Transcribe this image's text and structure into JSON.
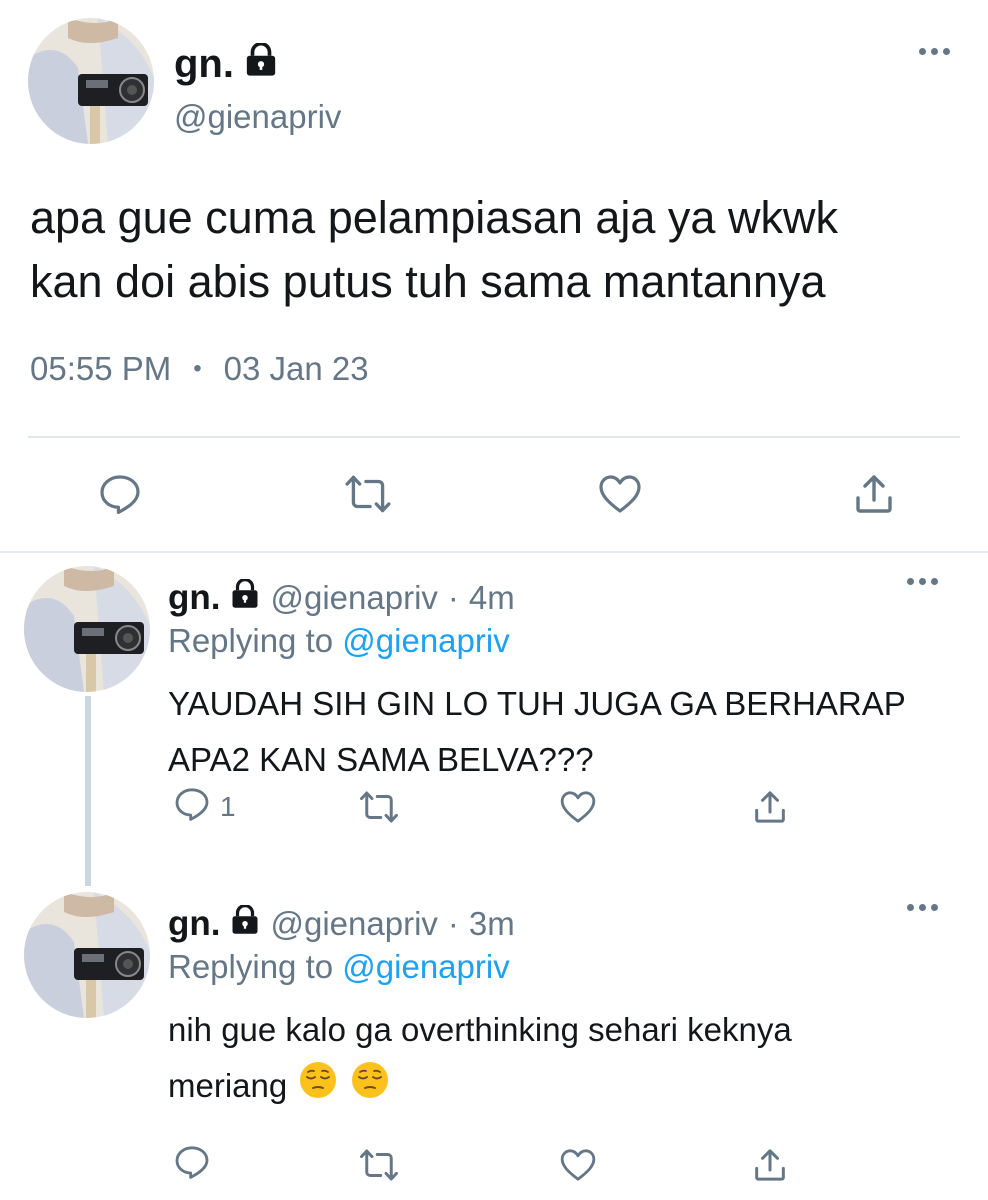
{
  "main_tweet": {
    "name": "gn.",
    "handle": "@gienapriv",
    "text_line1": "apa gue cuma pelampiasan aja ya wkwk",
    "text_line2": "kan doi abis putus tuh sama mantannya",
    "time": "05:55 PM",
    "separator": "•",
    "date": "03 Jan 23"
  },
  "replies": [
    {
      "name": "gn.",
      "handle": "@gienapriv",
      "dot": "·",
      "age": "4m",
      "replying_prefix": "Replying to",
      "replying_to": "@gienapriv",
      "text_line1": "YAUDAH SIH GIN LO TUH JUGA GA BERHARAP",
      "text_line2": "APA2 KAN SAMA BELVA???",
      "reply_count": "1"
    },
    {
      "name": "gn.",
      "handle": "@gienapriv",
      "dot": "·",
      "age": "3m",
      "replying_prefix": "Replying to",
      "replying_to": "@gienapriv",
      "text_line1": "nih gue kalo ga overthinking sehari keknya",
      "text_line2": "meriang",
      "emojis": [
        "pensive-face",
        "pensive-face"
      ],
      "reply_count": ""
    }
  ],
  "icons": {
    "lock": "lock-icon",
    "more": "more-icon",
    "reply": "reply-icon",
    "retweet": "retweet-icon",
    "like": "like-icon",
    "share": "share-icon"
  },
  "colors": {
    "text": "#14171a",
    "secondary": "#657786",
    "link": "#1da1f2",
    "divider": "#e1e8ed"
  }
}
